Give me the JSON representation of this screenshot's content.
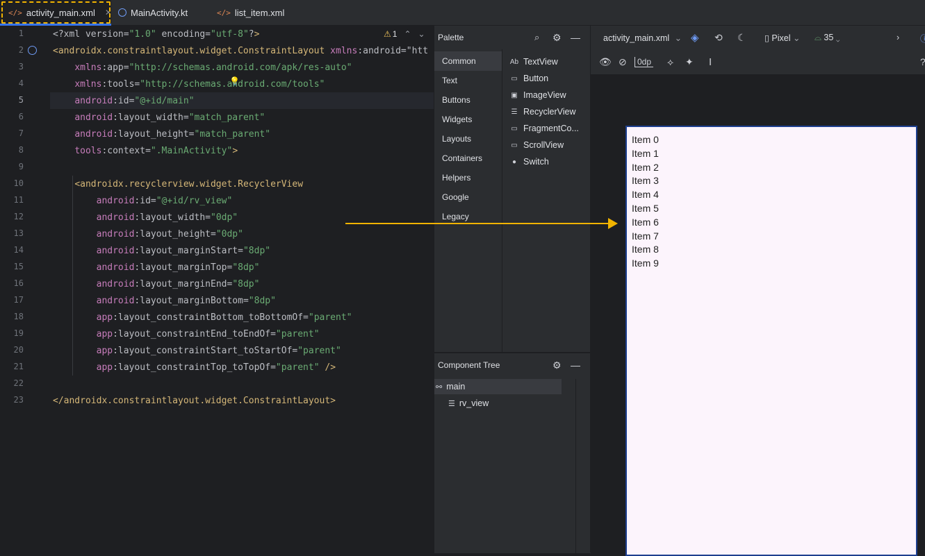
{
  "tabs": [
    {
      "label": "activity_main.xml",
      "icon": "xml-file-icon",
      "active": true,
      "closable": true
    },
    {
      "label": "MainActivity.kt",
      "icon": "kotlin-activity-icon",
      "active": false
    },
    {
      "label": "list_item.xml",
      "icon": "xml-file-icon",
      "active": false
    }
  ],
  "editor": {
    "warning_count": "1",
    "current_line": 5,
    "line_numbers": [
      "1",
      "2",
      "3",
      "4",
      "5",
      "6",
      "7",
      "8",
      "9",
      "10",
      "11",
      "12",
      "13",
      "14",
      "15",
      "16",
      "17",
      "18",
      "19",
      "20",
      "21",
      "22",
      "23"
    ],
    "lines": [
      "<?xml version=\"1.0\" encoding=\"utf-8\"?>",
      "<androidx.constraintlayout.widget.ConstraintLayout xmlns:android=\"htt",
      "    xmlns:app=\"http://schemas.android.com/apk/res-auto\"",
      "    xmlns:tools=\"http://schemas.android.com/tools\"",
      "    android:id=\"@+id/main\"",
      "    android:layout_width=\"match_parent\"",
      "    android:layout_height=\"match_parent\"",
      "    tools:context=\".MainActivity\">",
      "",
      "    <androidx.recyclerview.widget.RecyclerView",
      "        android:id=\"@+id/rv_view\"",
      "        android:layout_width=\"0dp\"",
      "        android:layout_height=\"0dp\"",
      "        android:layout_marginStart=\"8dp\"",
      "        android:layout_marginTop=\"8dp\"",
      "        android:layout_marginEnd=\"8dp\"",
      "        android:layout_marginBottom=\"8dp\"",
      "        app:layout_constraintBottom_toBottomOf=\"parent\"",
      "        app:layout_constraintEnd_toEndOf=\"parent\"",
      "        app:layout_constraintStart_toStartOf=\"parent\"",
      "        app:layout_constraintTop_toTopOf=\"parent\" />",
      "",
      "</androidx.constraintlayout.widget.ConstraintLayout>"
    ]
  },
  "palette": {
    "title": "Palette",
    "categories": [
      "Common",
      "Text",
      "Buttons",
      "Widgets",
      "Layouts",
      "Containers",
      "Helpers",
      "Google",
      "Legacy"
    ],
    "selected_category": "Common",
    "items": [
      {
        "label": "TextView",
        "icon": "Ab"
      },
      {
        "label": "Button",
        "icon": "▭"
      },
      {
        "label": "ImageView",
        "icon": "▣"
      },
      {
        "label": "RecyclerView",
        "icon": "☰"
      },
      {
        "label": "FragmentCo...",
        "icon": "▭"
      },
      {
        "label": "ScrollView",
        "icon": "▭"
      },
      {
        "label": "Switch",
        "icon": "●"
      }
    ]
  },
  "component_tree": {
    "title": "Component Tree",
    "nodes": [
      {
        "label": "main",
        "icon": "constraint-layout-icon"
      },
      {
        "label": "rv_view",
        "icon": "recyclerview-icon"
      }
    ]
  },
  "design": {
    "file_label": "activity_main.xml",
    "device": "Pixel",
    "api_level": "35",
    "margin_value": "0dp",
    "list_items": [
      "Item 0",
      "Item 1",
      "Item 2",
      "Item 3",
      "Item 4",
      "Item 5",
      "Item 6",
      "Item 7",
      "Item 8",
      "Item 9"
    ]
  },
  "colors": {
    "accent": "#3574f0",
    "highlight": "#f2b400",
    "arrow": "#f2b400",
    "preview_bg": "#fcf4fc"
  }
}
